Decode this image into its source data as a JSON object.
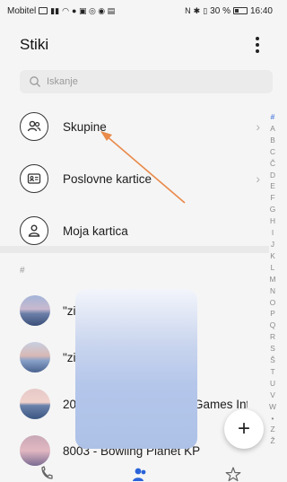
{
  "status_bar": {
    "carrier": "Mobitel",
    "battery": "30 %",
    "time": "16:40"
  },
  "header": {
    "title": "Stiki"
  },
  "search": {
    "placeholder": "Iskanje"
  },
  "quick_items": [
    {
      "label": "Skupine",
      "icon": "group-icon"
    },
    {
      "label": "Poslovne kartice",
      "icon": "business-card-icon"
    },
    {
      "label": "Moja kartica",
      "icon": "person-icon"
    }
  ],
  "section_header": "#",
  "contacts": [
    {
      "name": "\"zi"
    },
    {
      "name": "\"zi"
    },
    {
      "name": "20",
      "name_tail": "Games Int"
    },
    {
      "name": "8003 - Bowling Planet KP"
    }
  ],
  "index_letters": [
    "#",
    "A",
    "B",
    "C",
    "Č",
    "D",
    "E",
    "F",
    "G",
    "H",
    "I",
    "J",
    "K",
    "L",
    "M",
    "N",
    "O",
    "P",
    "Q",
    "R",
    "S",
    "Š",
    "T",
    "U",
    "V",
    "W",
    "•",
    "Z",
    "Ž"
  ],
  "fab": {
    "label": "+"
  },
  "bottom_nav": [
    "phone-icon",
    "contacts-icon",
    "favorites-icon"
  ],
  "colors": {
    "accent": "#2b63d9",
    "annotation": "#e98a4a"
  }
}
